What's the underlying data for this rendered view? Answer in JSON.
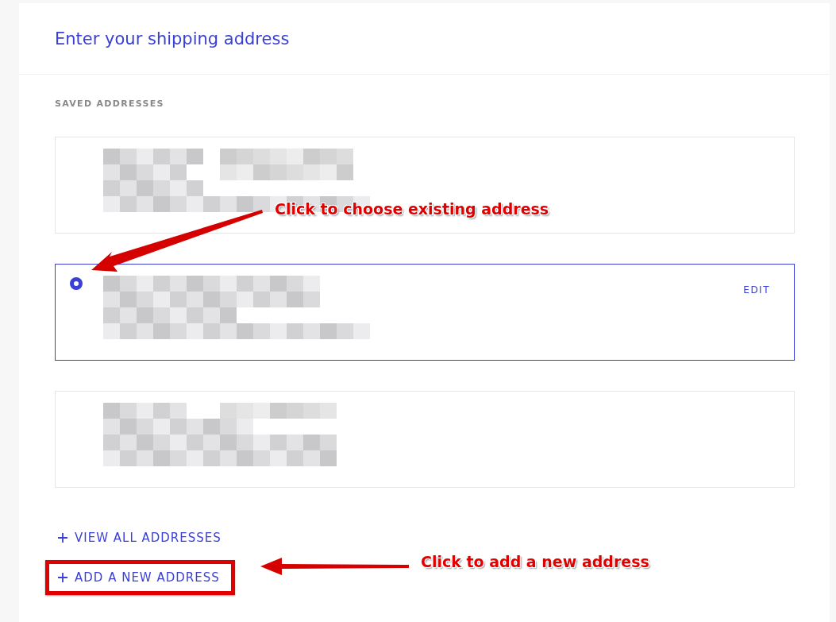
{
  "header": {
    "title": "Enter your shipping address"
  },
  "saved": {
    "heading": "SAVED ADDRESSES",
    "addresses": [
      {
        "selected": false
      },
      {
        "selected": true,
        "action": "EDIT"
      },
      {
        "selected": false
      }
    ]
  },
  "links": [
    {
      "label": "VIEW ALL ADDRESSES",
      "highlighted": false
    },
    {
      "label": "ADD A NEW ADDRESS",
      "highlighted": true
    }
  ],
  "annotations": [
    {
      "text": "Click to choose existing address"
    },
    {
      "text": "Click to add a new address"
    }
  ]
}
